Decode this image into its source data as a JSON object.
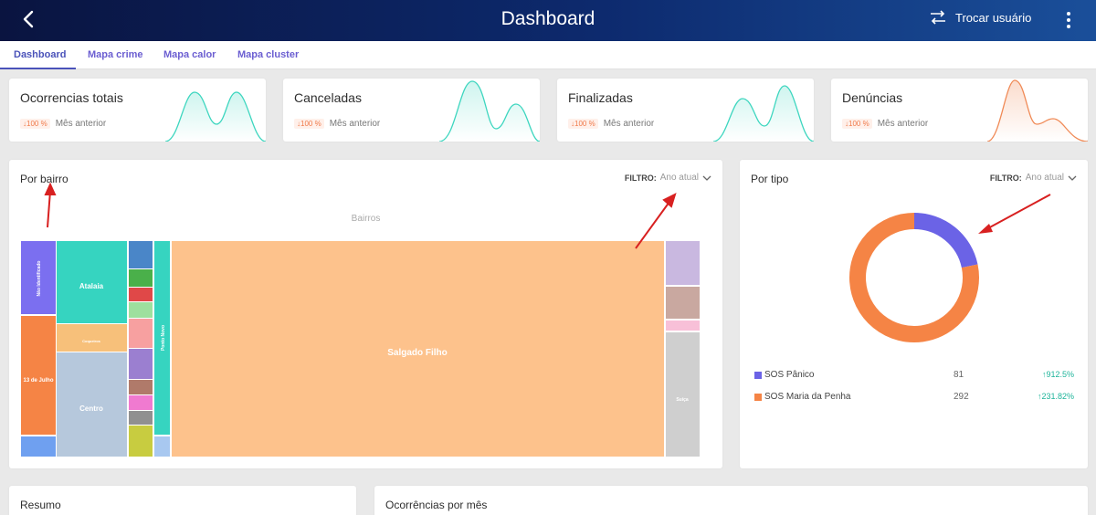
{
  "header": {
    "title": "Dashboard",
    "switch_user_label": "Trocar usuário"
  },
  "tabs": [
    "Dashboard",
    "Mapa crime",
    "Mapa calor",
    "Mapa cluster"
  ],
  "stats": [
    {
      "title": "Ocorrencias totais",
      "change": "100 %",
      "period": "Mês anterior",
      "color": "#3dd6bf"
    },
    {
      "title": "Canceladas",
      "change": "100 %",
      "period": "Mês anterior",
      "color": "#3dd6bf"
    },
    {
      "title": "Finalizadas",
      "change": "100 %",
      "period": "Mês anterior",
      "color": "#3dd6bf"
    },
    {
      "title": "Denúncias",
      "change": "100 %",
      "period": "Mês anterior",
      "color": "#f08a56"
    }
  ],
  "bairro": {
    "title": "Por bairro",
    "filter_label": "FILTRO:",
    "filter_value": "Ano atual",
    "chart_caption": "Bairros"
  },
  "tipo": {
    "title": "Por tipo",
    "filter_label": "FILTRO:",
    "filter_value": "Ano atual",
    "items": [
      {
        "name": "SOS Pânico",
        "value": "81",
        "change": "912.5%",
        "color": "#6b63e6"
      },
      {
        "name": "SOS Maria da Penha",
        "value": "292",
        "change": "231.82%",
        "color": "#f58445"
      }
    ]
  },
  "bottom": {
    "resumo_title": "Resumo",
    "mes_title": "Ocorrências por mês"
  },
  "chart_data": [
    {
      "type": "heatmap",
      "title": "Bairros",
      "series": [
        {
          "name": "Não Identificado",
          "color": "#7b6ff0"
        },
        {
          "name": "13 de Julho",
          "color": "#f58445"
        },
        {
          "name": "Atalaia",
          "color": "#36d4c0"
        },
        {
          "name": "Coqueiros",
          "color": "#f7c07a"
        },
        {
          "name": "Centro",
          "color": "#b6c8dc"
        },
        {
          "name": "Ponto Novo",
          "color": "#36d4c0"
        },
        {
          "name": "Salgado Filho",
          "color": "#fdc28c"
        },
        {
          "name": "Suíça",
          "color": "#cfcfcf"
        }
      ]
    },
    {
      "type": "pie",
      "categories": [
        "SOS Pânico",
        "SOS Maria da Penha"
      ],
      "values": [
        81,
        292
      ],
      "colors": [
        "#6b63e6",
        "#f58445"
      ]
    }
  ]
}
